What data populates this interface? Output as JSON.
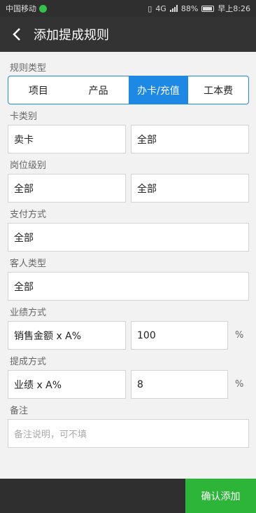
{
  "status_bar": {
    "carrier": "中国移动",
    "network": "4G",
    "battery": "88%",
    "time": "早上8:26"
  },
  "header": {
    "title": "添加提成规则"
  },
  "rule_type": {
    "label": "规则类型",
    "options": [
      "项目",
      "产品",
      "办卡/充值",
      "工本费"
    ],
    "selected": "办卡/充值"
  },
  "card_type": {
    "label": "卡类别",
    "value1": "卖卡",
    "value2": "全部"
  },
  "position_level": {
    "label": "岗位级别",
    "value1": "全部",
    "value2": "全部"
  },
  "payment_method": {
    "label": "支付方式",
    "value": "全部"
  },
  "customer_type": {
    "label": "客人类型",
    "value": "全部"
  },
  "performance_method": {
    "label": "业绩方式",
    "formula": "销售金额 x A%",
    "value": "100",
    "unit": "%"
  },
  "commission_method": {
    "label": "提成方式",
    "formula": "业绩 x A%",
    "value": "8",
    "unit": "%"
  },
  "remark": {
    "label": "备注",
    "placeholder": "备注说明，可不填"
  },
  "footer": {
    "confirm_label": "确认添加"
  },
  "colors": {
    "accent": "#1e88e5",
    "confirm": "#2db53a",
    "header": "#333333"
  }
}
